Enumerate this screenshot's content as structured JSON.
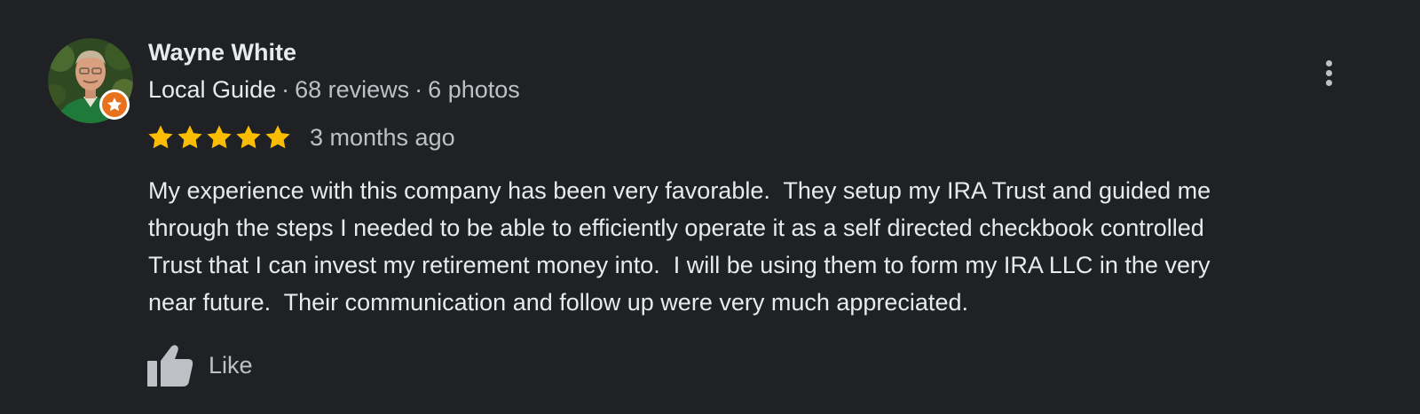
{
  "reviewer": {
    "name": "Wayne White",
    "guide_label": "Local Guide",
    "separator": "·",
    "reviews": "68 reviews",
    "photos": "6 photos",
    "badge_icon": "star-icon",
    "badge_color": "#e8711c"
  },
  "review": {
    "rating": 5,
    "rating_max": 5,
    "star_color": "#fbbc04",
    "time": "3 months ago",
    "text_lines": [
      "My experience with this company has been very favorable.  They setup my IRA Trust and guided me",
      "through the steps I needed to be able to efficiently operate it as a self directed checkbook controlled",
      "Trust that I can invest my retirement money into.  I will be using them to form my IRA LLC in the very",
      "near future.  Their communication and follow up were very much appreciated."
    ]
  },
  "actions": {
    "like_label": "Like",
    "like_icon": "thumbs-up-icon",
    "more_icon": "more-vert-icon"
  },
  "colors": {
    "background": "#202124",
    "text_primary": "#e8eaed",
    "text_secondary": "#bdc1c6"
  }
}
